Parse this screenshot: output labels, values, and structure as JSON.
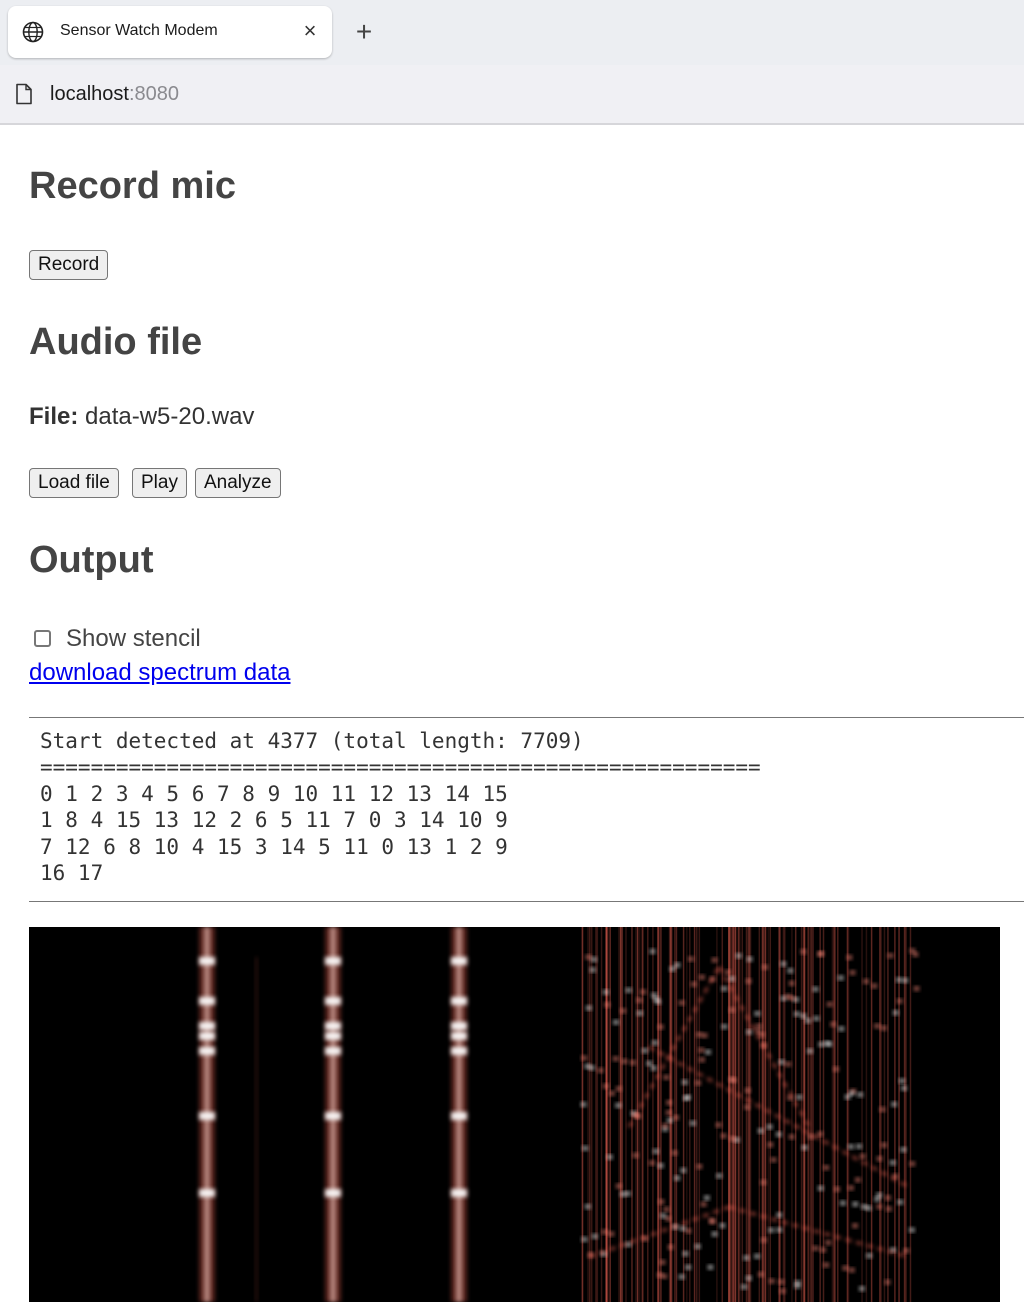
{
  "browser": {
    "tab_title": "Sensor Watch Modem",
    "close_glyph": "×",
    "newtab_glyph": "+",
    "url_host": "localhost",
    "url_port": ":8080"
  },
  "record_section": {
    "heading": "Record mic",
    "record_button": "Record"
  },
  "audio_section": {
    "heading": "Audio file",
    "file_label": "File:",
    "file_name": "data-w5-20.wav",
    "load_button": "Load file",
    "play_button": "Play",
    "analyze_button": "Analyze"
  },
  "output_section": {
    "heading": "Output",
    "show_stencil_label": "Show stencil",
    "show_stencil_checked": false,
    "download_link": "download spectrum data",
    "log_lines": [
      "Start detected at 4377 (total length: 7709)",
      "=========================================================",
      "0 1 2 3 4 5 6 7 8 9 10 11 12 13 14 15",
      "1 8 4 15 13 12 2 6 5 11 7 0 3 14 10 9",
      "7 12 6 8 10 4 15 3 14 5 11 0 13 1 2 9",
      "16 17"
    ]
  },
  "icons": {
    "tab_icon": "globe-icon",
    "page_icon": "document-icon"
  },
  "colors": {
    "heading": "#444444",
    "link": "#0000ee",
    "spectrogram_bg": "#000000",
    "spectrogram_glow": "#ff6a5a"
  }
}
